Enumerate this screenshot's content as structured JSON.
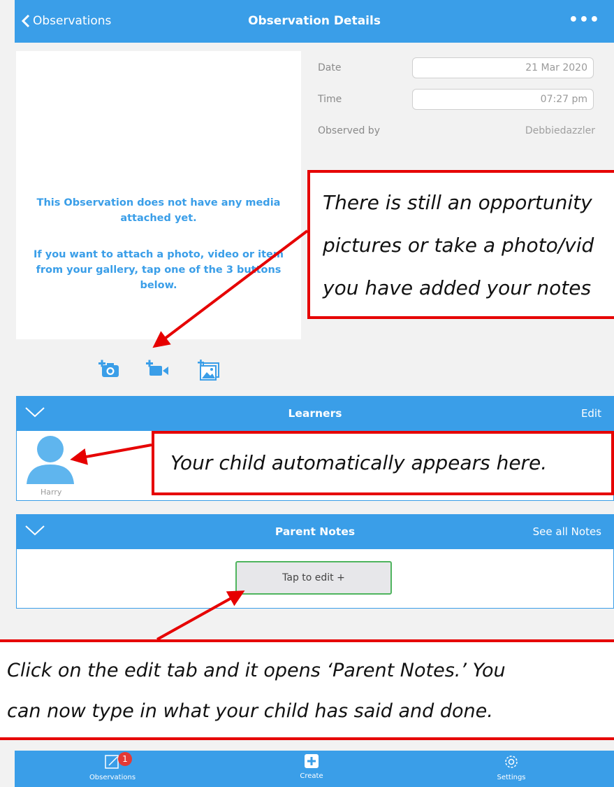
{
  "header": {
    "back_label": "Observations",
    "title": "Observation Details",
    "more_label": "•••"
  },
  "media": {
    "empty_message": "This Observation does not have any media attached yet.",
    "instruction": "If you want to attach a photo, video or item from your gallery, tap one of the 3 buttons below.",
    "buttons": [
      "camera-add-icon",
      "video-add-icon",
      "gallery-add-icon"
    ]
  },
  "details": {
    "date_label": "Date",
    "date_value": "21 Mar 2020",
    "time_label": "Time",
    "time_value": "07:27 pm",
    "observed_label": "Observed by",
    "observed_value": "Debbiedazzler"
  },
  "learners": {
    "title": "Learners",
    "action": "Edit",
    "items": [
      {
        "name": "Harry"
      }
    ]
  },
  "parent_notes": {
    "title": "Parent Notes",
    "action": "See all Notes",
    "tap_button": "Tap to edit +"
  },
  "annotations": {
    "media": [
      "There is still an opportunity",
      "pictures or take a photo/vid",
      "you have added your notes"
    ],
    "learners": "Your child automatically appears here.",
    "notes": [
      "Click on the edit tab and it opens ‘Parent Notes.’ You",
      "can now type in what your child has said and done."
    ]
  },
  "tabbar": {
    "items": [
      {
        "label": "Observations",
        "badge": "1"
      },
      {
        "label": "Create"
      },
      {
        "label": "Settings"
      }
    ]
  },
  "colors": {
    "accent": "#3a9ee8",
    "annotation_border": "#e60000",
    "button_border": "#4fb45e"
  }
}
